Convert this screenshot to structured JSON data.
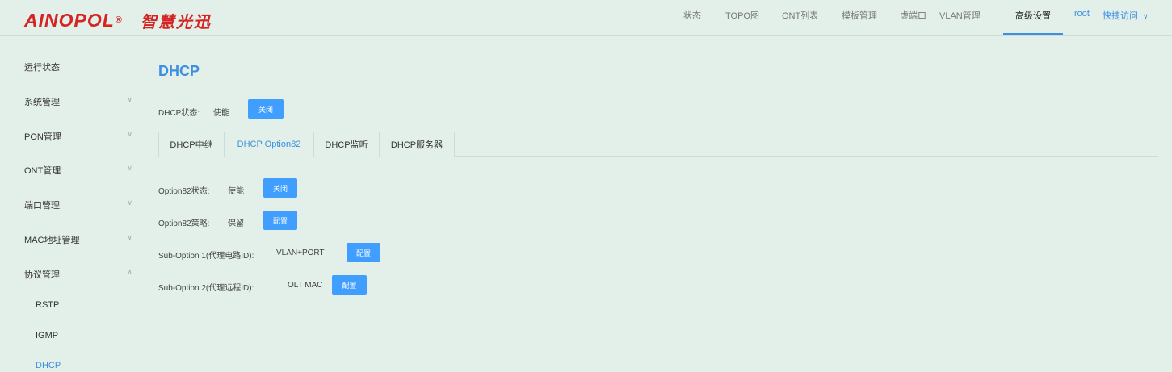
{
  "header": {
    "logo_brand": "AINOPOL",
    "logo_reg": "®",
    "logo_cn": "智慧光迅",
    "nav": [
      "状态",
      "TOPO图",
      "ONT列表",
      "模板管理",
      "虚端口",
      "VLAN管理",
      "高级设置"
    ],
    "active_nav": "高级设置",
    "user": "root",
    "quick_access": "快捷访问",
    "accent": "#3d8fe0"
  },
  "sidebar": {
    "items": [
      {
        "label": "运行状态"
      },
      {
        "label": "系统管理"
      },
      {
        "label": "PON管理"
      },
      {
        "label": "ONT管理"
      },
      {
        "label": "端口管理"
      },
      {
        "label": "MAC地址管理"
      },
      {
        "label": "协议管理"
      }
    ],
    "sub_items": [
      "RSTP",
      "IGMP",
      "DHCP"
    ],
    "active_sub": "DHCP"
  },
  "main": {
    "title": "DHCP",
    "dhcp_status_label": "DHCP状态:",
    "dhcp_status_value": "使能",
    "dhcp_close_btn": "关闭",
    "tabs": [
      "DHCP中继",
      "DHCP Option82",
      "DHCP监听",
      "DHCP服务器"
    ],
    "active_tab": "DHCP Option82",
    "option82": {
      "status_label": "Option82状态:",
      "status_value": "使能",
      "status_btn": "关闭",
      "policy_label": "Option82策略:",
      "policy_value": "保留",
      "policy_btn": "配置",
      "sub1_label": "Sub-Option 1(代理电路ID):",
      "sub1_value": "VLAN+PORT",
      "sub1_btn": "配置",
      "sub2_label": "Sub-Option 2(代理远程ID):",
      "sub2_value": "OLT MAC",
      "sub2_btn": "配置"
    }
  }
}
